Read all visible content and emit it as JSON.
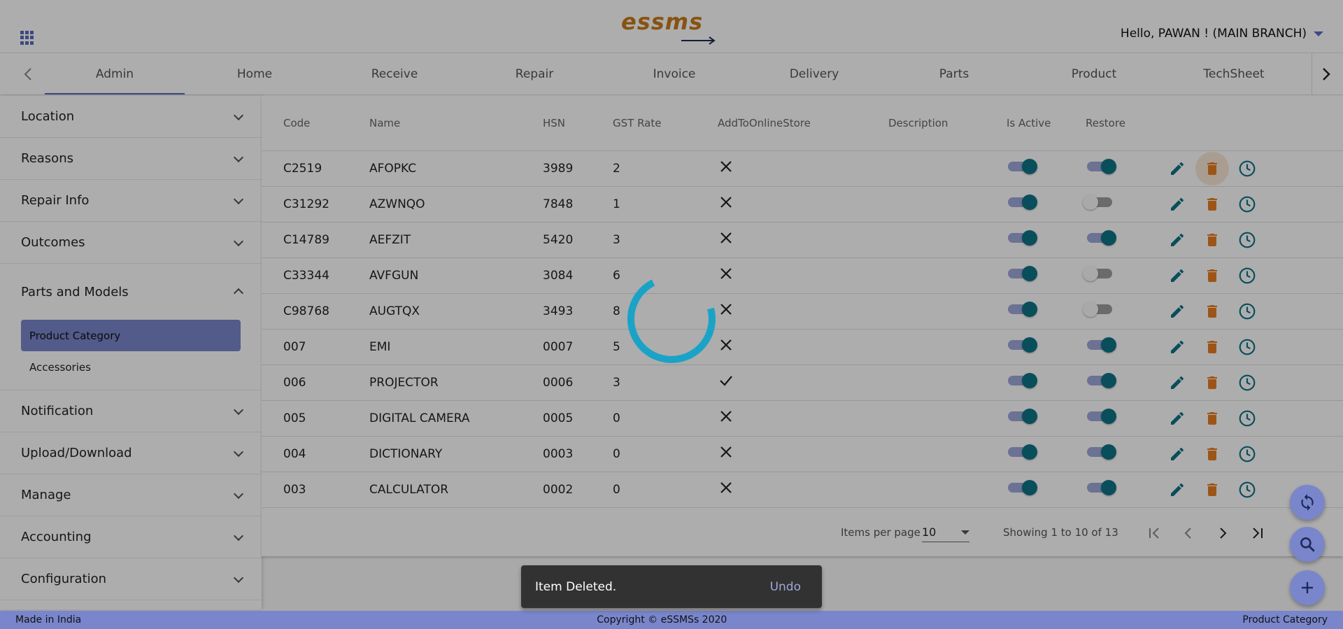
{
  "header": {
    "logo_text": "essms",
    "greeting": "Hello, PAWAN ! (MAIN BRANCH)"
  },
  "tabs": [
    {
      "label": "Admin",
      "active": true
    },
    {
      "label": "Home"
    },
    {
      "label": "Receive"
    },
    {
      "label": "Repair"
    },
    {
      "label": "Invoice"
    },
    {
      "label": "Delivery"
    },
    {
      "label": "Parts"
    },
    {
      "label": "Product"
    },
    {
      "label": "TechSheet"
    }
  ],
  "sidebar": {
    "items": [
      {
        "label": "Location"
      },
      {
        "label": "Reasons"
      },
      {
        "label": "Repair Info"
      },
      {
        "label": "Outcomes"
      },
      {
        "label": "Parts and Models",
        "expanded": true
      },
      {
        "label": "Notification"
      },
      {
        "label": "Upload/Download"
      },
      {
        "label": "Manage"
      },
      {
        "label": "Accounting"
      },
      {
        "label": "Configuration"
      }
    ],
    "subitems": [
      {
        "label": "Product Category",
        "active": true
      },
      {
        "label": "Accessories"
      }
    ]
  },
  "table": {
    "columns": [
      "Code",
      "Name",
      "HSN",
      "GST Rate",
      "AddToOnlineStore",
      "Description",
      "Is Active",
      "Restore"
    ],
    "rows": [
      {
        "code": "C2519",
        "name": "AFOPKC",
        "hsn": "3989",
        "gst": "2",
        "store": false,
        "description": "",
        "active": true,
        "restore": true
      },
      {
        "code": "C31292",
        "name": "AZWNQO",
        "hsn": "7848",
        "gst": "1",
        "store": false,
        "description": "",
        "active": true,
        "restore": false
      },
      {
        "code": "C14789",
        "name": "AEFZIT",
        "hsn": "5420",
        "gst": "3",
        "store": false,
        "description": "",
        "active": true,
        "restore": true
      },
      {
        "code": "C33344",
        "name": "AVFGUN",
        "hsn": "3084",
        "gst": "6",
        "store": false,
        "description": "",
        "active": true,
        "restore": false
      },
      {
        "code": "C98768",
        "name": "AUGTQX",
        "hsn": "3493",
        "gst": "8",
        "store": false,
        "description": "",
        "active": true,
        "restore": false
      },
      {
        "code": "007",
        "name": "EMI",
        "hsn": "0007",
        "gst": "5",
        "store": false,
        "description": "",
        "active": true,
        "restore": true
      },
      {
        "code": "006",
        "name": "PROJECTOR",
        "hsn": "0006",
        "gst": "3",
        "store": true,
        "description": "",
        "active": true,
        "restore": true
      },
      {
        "code": "005",
        "name": "DIGITAL CAMERA",
        "hsn": "0005",
        "gst": "0",
        "store": false,
        "description": "",
        "active": true,
        "restore": true
      },
      {
        "code": "004",
        "name": "DICTIONARY",
        "hsn": "0003",
        "gst": "0",
        "store": false,
        "description": "",
        "active": true,
        "restore": true
      },
      {
        "code": "003",
        "name": "CALCULATOR",
        "hsn": "0002",
        "gst": "0",
        "store": false,
        "description": "",
        "active": true,
        "restore": true
      }
    ]
  },
  "paginator": {
    "items_per_page_label": "Items per page",
    "items_per_page_value": "10",
    "range_label": "Showing 1 to 10 of 13"
  },
  "snackbar": {
    "message": "Item Deleted.",
    "action": "Undo"
  },
  "footer": {
    "left": "Made in India",
    "center": "Copyright © eSSMSs 2020",
    "right": "Product Category"
  },
  "icons": {
    "apps": "apps-grid-icon",
    "edit": "pencil-icon",
    "delete": "trash-icon",
    "history": "clock-icon",
    "refresh": "refresh-icon",
    "search": "search-icon",
    "add": "plus-icon"
  },
  "colors": {
    "primary": "#7986cb",
    "teal": "#0e7387",
    "orange": "#e67e22",
    "logo": "#c77b1a",
    "spinner": "#1aa3c7"
  }
}
